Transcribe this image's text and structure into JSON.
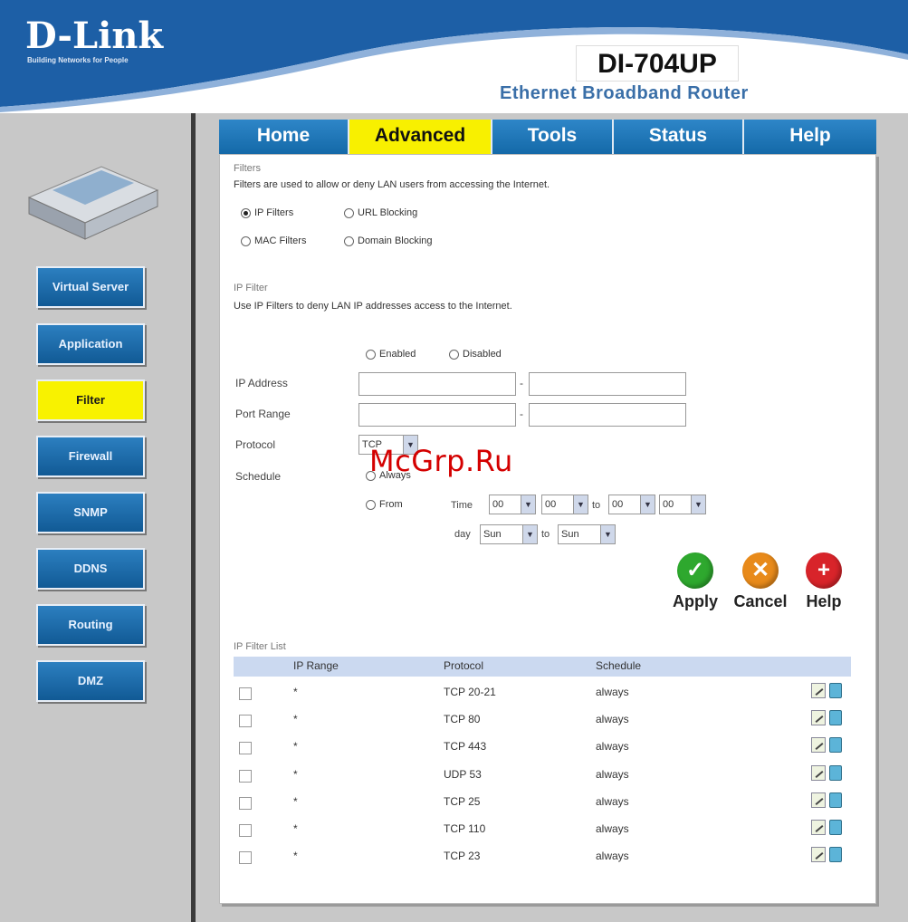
{
  "header": {
    "logo": "D-Link",
    "logo_tagline": "Building Networks for People",
    "model": "DI-704UP",
    "subtitle": "Ethernet Broadband Router"
  },
  "nav": {
    "tabs": [
      {
        "label": "Home"
      },
      {
        "label": "Advanced"
      },
      {
        "label": "Tools"
      },
      {
        "label": "Status"
      },
      {
        "label": "Help"
      }
    ],
    "active": "Advanced"
  },
  "sidebar": {
    "items": [
      {
        "label": "Virtual Server"
      },
      {
        "label": "Application"
      },
      {
        "label": "Filter"
      },
      {
        "label": "Firewall"
      },
      {
        "label": "SNMP"
      },
      {
        "label": "DDNS"
      },
      {
        "label": "Routing"
      },
      {
        "label": "DMZ"
      }
    ],
    "active": "Filter"
  },
  "filters": {
    "title": "Filters",
    "description": "Filters are used to allow or deny LAN users from accessing the Internet.",
    "options": [
      {
        "label": "IP Filters",
        "selected": true
      },
      {
        "label": "URL Blocking",
        "selected": false
      },
      {
        "label": "MAC Filters",
        "selected": false
      },
      {
        "label": "Domain Blocking",
        "selected": false
      }
    ]
  },
  "ip_filter": {
    "title": "IP Filter",
    "description": "Use IP Filters to deny LAN IP addresses access to the Internet.",
    "enable_label": "Enabled",
    "disable_label": "Disabled",
    "ip_address_label": "IP Address",
    "port_range_label": "Port Range",
    "protocol_label": "Protocol",
    "protocol_value": "TCP",
    "schedule_label": "Schedule",
    "always_label": "Always",
    "from_label": "From",
    "time_label": "Time",
    "to_label": "to",
    "day_label": "day",
    "time_from_hour": "00",
    "time_from_min": "00",
    "time_to_hour": "00",
    "time_to_min": "00",
    "day_from": "Sun",
    "day_to": "Sun"
  },
  "actions": {
    "apply": "Apply",
    "cancel": "Cancel",
    "help": "Help",
    "colors": {
      "apply": "#2ea82e",
      "cancel": "#e88a1a",
      "help": "#d8242a"
    }
  },
  "list": {
    "title": "IP Filter List",
    "headers": {
      "ip_range": "IP Range",
      "protocol": "Protocol",
      "schedule": "Schedule"
    },
    "rows": [
      {
        "ip": "*",
        "protocol": "TCP 20-21",
        "schedule": "always"
      },
      {
        "ip": "*",
        "protocol": "TCP 80",
        "schedule": "always"
      },
      {
        "ip": "*",
        "protocol": "TCP 443",
        "schedule": "always"
      },
      {
        "ip": "*",
        "protocol": "UDP 53",
        "schedule": "always"
      },
      {
        "ip": "*",
        "protocol": "TCP 25",
        "schedule": "always"
      },
      {
        "ip": "*",
        "protocol": "TCP 110",
        "schedule": "always"
      },
      {
        "ip": "*",
        "protocol": "TCP 23",
        "schedule": "always"
      }
    ]
  },
  "watermark": "McGrp.Ru",
  "colors": {
    "brand_blue": "#1469a8",
    "active_yellow": "#f8f000"
  }
}
